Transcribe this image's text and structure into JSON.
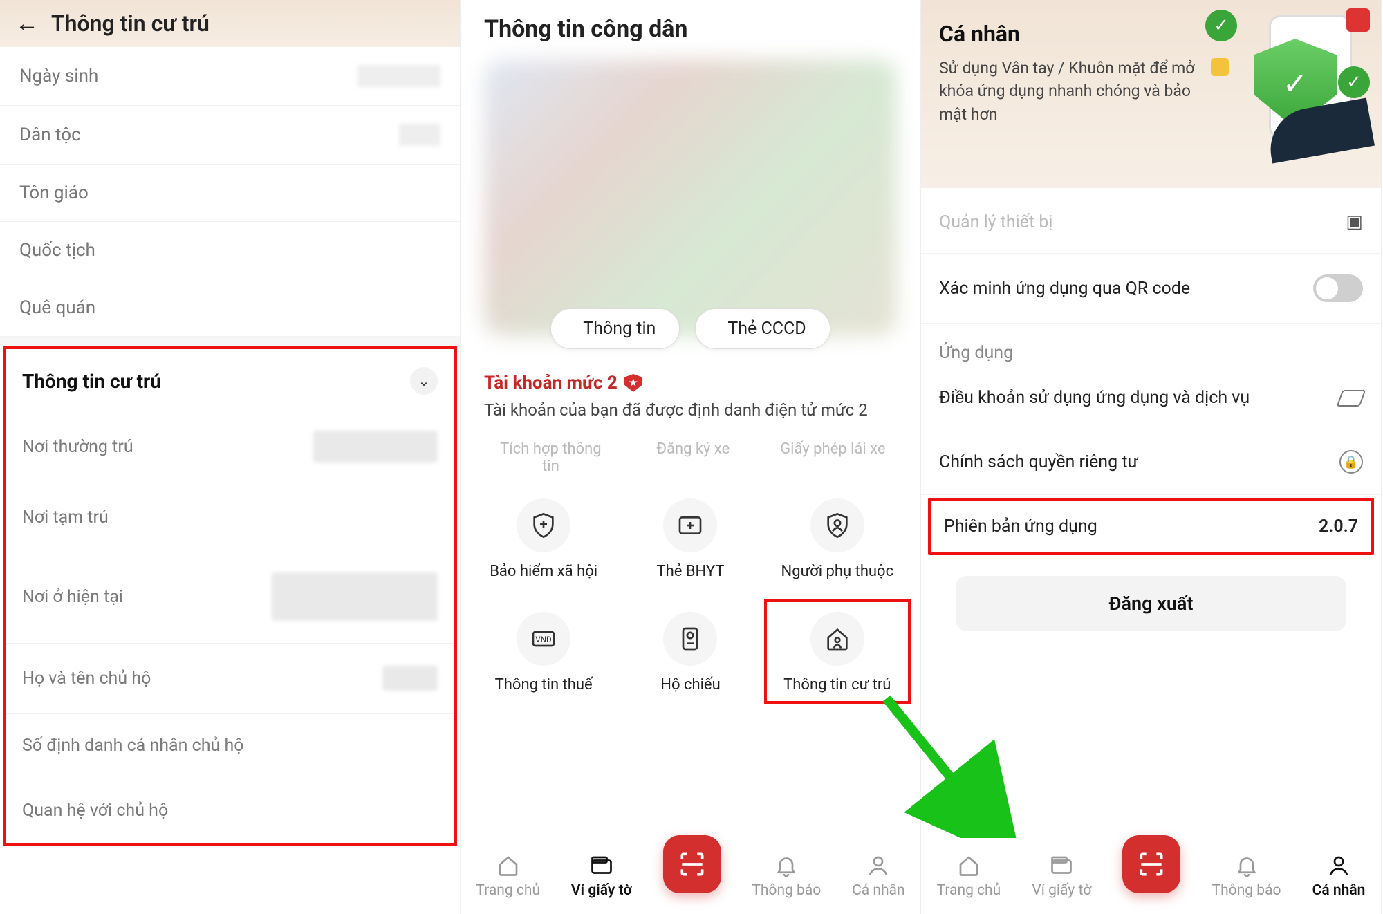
{
  "phone1": {
    "header_title": "Thông tin cư trú",
    "rows_top": [
      {
        "label": "Ngày sinh"
      },
      {
        "label": "Dân tộc"
      },
      {
        "label": "Tôn giáo"
      },
      {
        "label": "Quốc tịch"
      },
      {
        "label": "Quê quán"
      }
    ],
    "section_title": "Thông tin cư trú",
    "rows_bottom": [
      {
        "label": "Nơi thường trú"
      },
      {
        "label": "Nơi tạm trú"
      },
      {
        "label": "Nơi ở hiện tại"
      },
      {
        "label": "Họ và tên chủ hộ"
      },
      {
        "label": "Số định danh cá nhân chủ hộ"
      },
      {
        "label": "Quan hệ với chủ hộ"
      }
    ]
  },
  "phone2": {
    "title": "Thông tin công dân",
    "pill_info": "Thông tin",
    "pill_card": "Thẻ CCCD",
    "acc_title": "Tài khoản mức 2",
    "acc_desc": "Tài khoản của bạn đã được định danh điện tử mức 2",
    "faded_row": [
      "Tích hợp thông tin",
      "Đăng ký xe",
      "Giấy phép lái xe"
    ],
    "grid": [
      {
        "label": "Bảo hiểm xã hội",
        "icon": "shield-plus"
      },
      {
        "label": "Thẻ BHYT",
        "icon": "card-plus"
      },
      {
        "label": "Người phụ thuộc",
        "icon": "person-shield"
      },
      {
        "label": "Thông tin thuế",
        "icon": "vnd-card"
      },
      {
        "label": "Hộ chiếu",
        "icon": "passport"
      },
      {
        "label": "Thông tin cư trú",
        "icon": "house-person",
        "highlight": true
      }
    ],
    "bottom_nav": {
      "home": "Trang chủ",
      "wallet": "Ví giấy tờ",
      "noti": "Thông báo",
      "profile": "Cá nhân"
    }
  },
  "phone3": {
    "banner_title": "Cá nhân",
    "banner_desc": "Sử dụng Vân tay / Khuôn mặt để mở  khóa ứng dụng nhanh chóng và bảo mật hơn",
    "row_partial": "Quản lý thiết bị",
    "row_qr": "Xác minh ứng dụng qua QR code",
    "section_app": "Ứng dụng",
    "row_terms": "Điều khoản sử dụng ứng dụng và dịch vụ",
    "row_privacy": "Chính sách quyền riêng tư",
    "row_version_label": "Phiên bản ứng dụng",
    "row_version_value": "2.0.7",
    "logout": "Đăng xuất",
    "bottom_nav": {
      "home": "Trang chủ",
      "wallet": "Ví giấy tờ",
      "noti": "Thông báo",
      "profile": "Cá nhân"
    }
  }
}
